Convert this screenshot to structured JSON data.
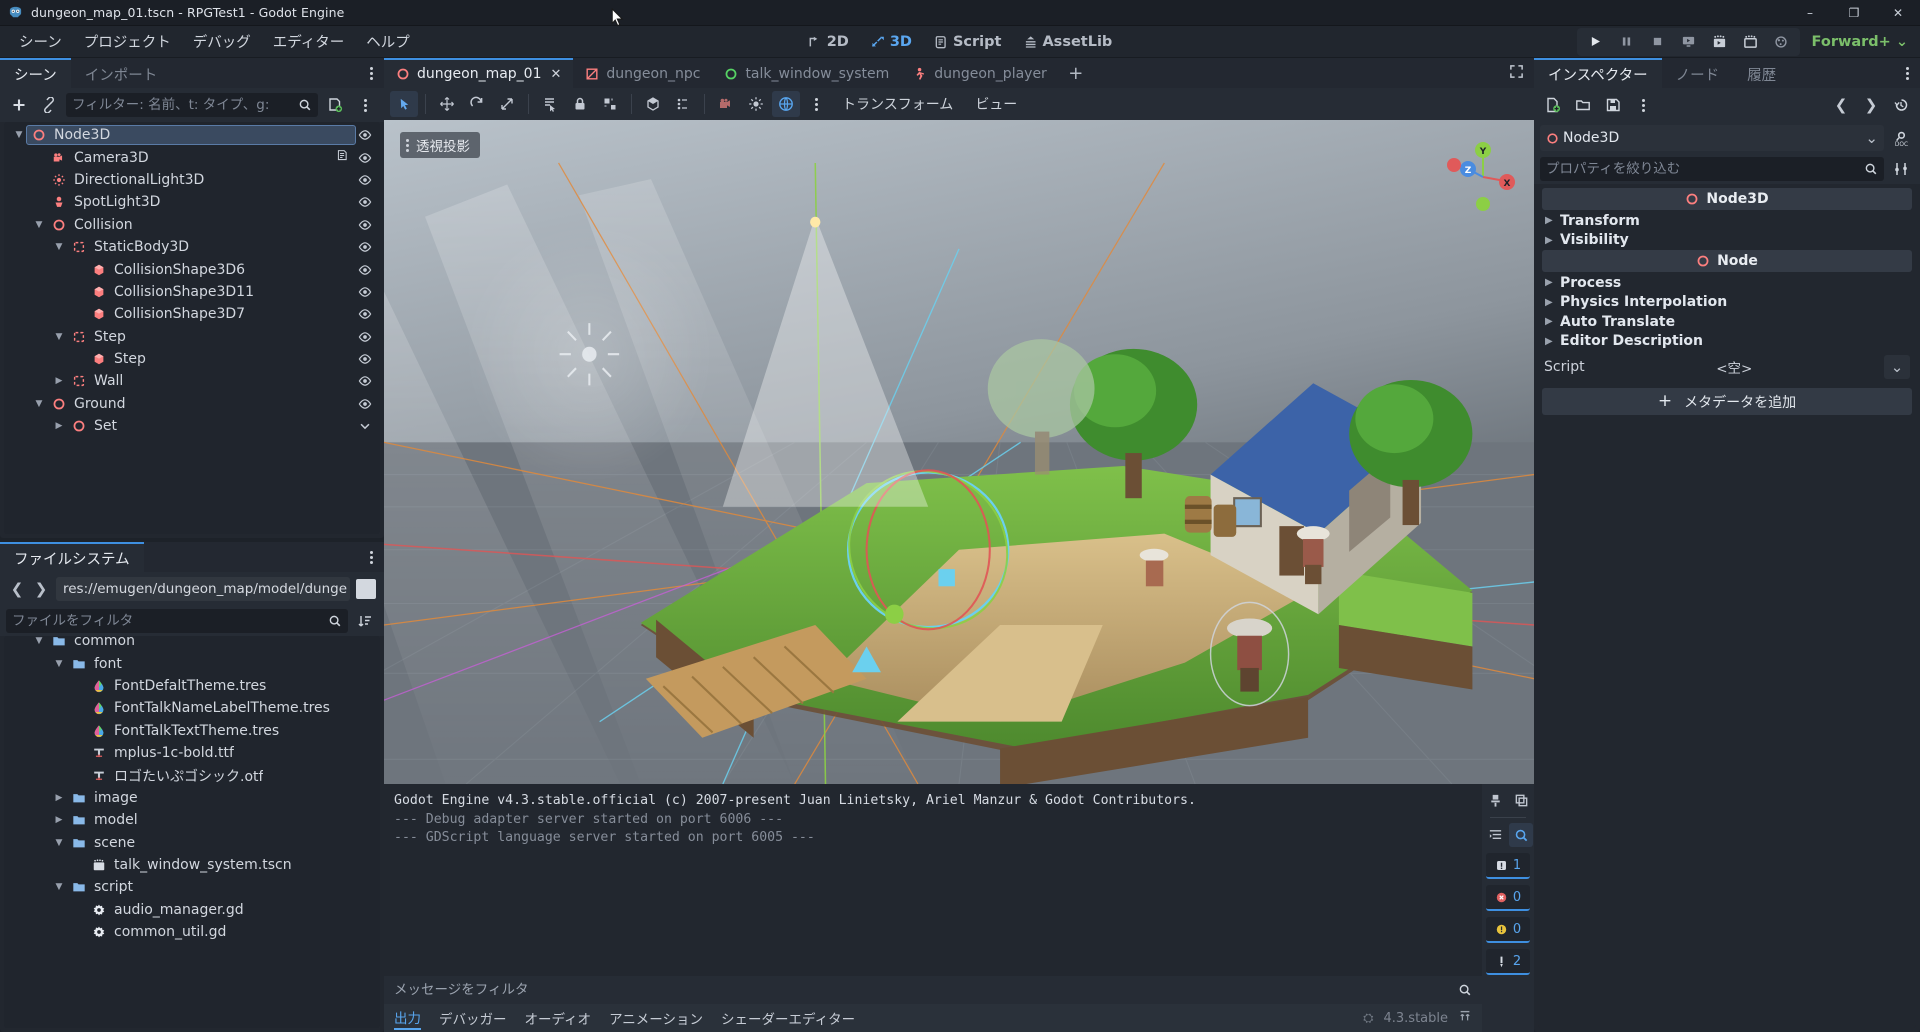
{
  "window": {
    "title": "dungeon_map_01.tscn - RPGTest1 - Godot Engine",
    "minimize": "–",
    "maximize": "❐",
    "close": "✕"
  },
  "menubar": {
    "items": [
      {
        "label": "シーン"
      },
      {
        "label": "プロジェクト"
      },
      {
        "label": "デバッグ"
      },
      {
        "label": "エディター"
      },
      {
        "label": "ヘルプ"
      }
    ],
    "main_tabs": [
      {
        "label": "2D",
        "active": false
      },
      {
        "label": "3D",
        "active": true
      },
      {
        "label": "Script",
        "active": false
      },
      {
        "label": "AssetLib",
        "active": false
      }
    ],
    "run_buttons": [
      {
        "name": "play-button"
      },
      {
        "name": "pause-button"
      },
      {
        "name": "stop-button"
      },
      {
        "name": "run-specific-scene-button"
      },
      {
        "name": "movie-maker-button"
      },
      {
        "name": "remote-debug-button"
      },
      {
        "name": "render-settings-button"
      }
    ],
    "renderer": "Forward+"
  },
  "scene_dock": {
    "tabs": [
      {
        "label": "シーン",
        "active": true
      },
      {
        "label": "インポート",
        "active": false
      }
    ],
    "filter_placeholder": "フィルター: 名前、t: タイプ、g:",
    "tree": [
      {
        "label": "Node3D",
        "depth": 0,
        "icon": "node3d",
        "arrow": "down",
        "selected": true,
        "eye": "visible"
      },
      {
        "label": "Camera3D",
        "depth": 1,
        "icon": "camera",
        "arrow": "none",
        "selected": false,
        "eye": "visible",
        "extra": "script-icon"
      },
      {
        "label": "DirectionalLight3D",
        "depth": 1,
        "icon": "sunlight",
        "arrow": "none",
        "selected": false,
        "eye": "visible"
      },
      {
        "label": "SpotLight3D",
        "depth": 1,
        "icon": "spotlight",
        "arrow": "none",
        "selected": false,
        "eye": "visible"
      },
      {
        "label": "Collision",
        "depth": 1,
        "icon": "node3d",
        "arrow": "down",
        "selected": false,
        "eye": "visible"
      },
      {
        "label": "StaticBody3D",
        "depth": 2,
        "icon": "body",
        "arrow": "down",
        "selected": false,
        "eye": "visible"
      },
      {
        "label": "CollisionShape3D6",
        "depth": 3,
        "icon": "shape",
        "arrow": "none",
        "selected": false,
        "eye": "visible"
      },
      {
        "label": "CollisionShape3D11",
        "depth": 3,
        "icon": "shape",
        "arrow": "none",
        "selected": false,
        "eye": "visible"
      },
      {
        "label": "CollisionShape3D7",
        "depth": 3,
        "icon": "shape",
        "arrow": "none",
        "selected": false,
        "eye": "visible"
      },
      {
        "label": "Step",
        "depth": 2,
        "icon": "body",
        "arrow": "down",
        "selected": false,
        "eye": "visible"
      },
      {
        "label": "Step",
        "depth": 3,
        "icon": "shape",
        "arrow": "none",
        "selected": false,
        "eye": "visible"
      },
      {
        "label": "Wall",
        "depth": 2,
        "icon": "body",
        "arrow": "right",
        "selected": false,
        "eye": "visible"
      },
      {
        "label": "Ground",
        "depth": 1,
        "icon": "node3d",
        "arrow": "down",
        "selected": false,
        "eye": "visible"
      },
      {
        "label": "Set",
        "depth": 2,
        "icon": "node3d",
        "arrow": "right",
        "selected": false,
        "eye": "chevron"
      }
    ]
  },
  "filesystem_dock": {
    "tabs": [
      {
        "label": "ファイルシステム",
        "active": true
      }
    ],
    "path": "res://emugen/dungeon_map/model/dunge",
    "filter_placeholder": "ファイルをフィルタ",
    "tree": [
      {
        "label": "common",
        "depth": 1,
        "icon": "folder",
        "arrow": "down",
        "partial": true
      },
      {
        "label": "font",
        "depth": 2,
        "icon": "folder",
        "arrow": "down"
      },
      {
        "label": "FontDefaltTheme.tres",
        "depth": 3,
        "icon": "theme",
        "arrow": "none"
      },
      {
        "label": "FontTalkNameLabelTheme.tres",
        "depth": 3,
        "icon": "theme",
        "arrow": "none"
      },
      {
        "label": "FontTalkTextTheme.tres",
        "depth": 3,
        "icon": "theme",
        "arrow": "none"
      },
      {
        "label": "mplus-1c-bold.ttf",
        "depth": 3,
        "icon": "font",
        "arrow": "none"
      },
      {
        "label": "ロゴたいぷゴシック.otf",
        "depth": 3,
        "icon": "font",
        "arrow": "none"
      },
      {
        "label": "image",
        "depth": 2,
        "icon": "folder",
        "arrow": "right"
      },
      {
        "label": "model",
        "depth": 2,
        "icon": "folder",
        "arrow": "right"
      },
      {
        "label": "scene",
        "depth": 2,
        "icon": "folder",
        "arrow": "down"
      },
      {
        "label": "talk_window_system.tscn",
        "depth": 3,
        "icon": "scene",
        "arrow": "none"
      },
      {
        "label": "script",
        "depth": 2,
        "icon": "folder",
        "arrow": "down"
      },
      {
        "label": "audio_manager.gd",
        "depth": 3,
        "icon": "gd",
        "arrow": "none"
      },
      {
        "label": "common_util.gd",
        "depth": 3,
        "icon": "gd",
        "arrow": "none"
      }
    ]
  },
  "scene_tabs": [
    {
      "label": "dungeon_map_01",
      "icon": "node3d",
      "active": true,
      "closable": true
    },
    {
      "label": "dungeon_npc",
      "icon": "sprite",
      "active": false,
      "closable": false
    },
    {
      "label": "talk_window_system",
      "icon": "control",
      "active": false,
      "closable": false
    },
    {
      "label": "dungeon_player",
      "icon": "player",
      "active": false,
      "closable": false
    }
  ],
  "viewport_toolbar": {
    "buttons": [
      {
        "name": "select-mode-button",
        "on": true
      },
      {
        "name": "move-mode-button",
        "on": false
      },
      {
        "name": "rotate-mode-button",
        "on": false
      },
      {
        "name": "scale-mode-button",
        "on": false
      },
      {
        "name": "list-select-button",
        "on": false
      },
      {
        "name": "lock-button",
        "on": false
      },
      {
        "name": "group-button",
        "on": false
      },
      {
        "name": "local-space-button",
        "on": false
      },
      {
        "name": "snap-button",
        "on": false
      },
      {
        "name": "camera-preview-button",
        "on": false
      },
      {
        "name": "preview-sun-button",
        "on": false
      },
      {
        "name": "preview-env-button",
        "on": true
      },
      {
        "name": "viewport-options-button",
        "on": false
      }
    ],
    "transform_menu": "トランスフォーム",
    "view_menu": "ビュー",
    "projection_label": "透視投影",
    "gizmo_axes": [
      {
        "label": "Y",
        "color": "#8ccf45"
      },
      {
        "label": "X",
        "color": "#e05a5a"
      },
      {
        "label": "Z",
        "color": "#4a8ce0"
      }
    ]
  },
  "output": {
    "lines": [
      {
        "text": "Godot Engine v4.3.stable.official (c) 2007-present Juan Linietsky, Ariel Manzur & Godot Contributors.",
        "dim": false
      },
      {
        "text": "--- Debug adapter server started on port 6006 ---",
        "dim": true
      },
      {
        "text": "--- GDScript language server started on port 6005 ---",
        "dim": true
      }
    ],
    "filter_placeholder": "メッセージをフィルタ",
    "bottom_tabs": [
      {
        "label": "出力",
        "active": true
      },
      {
        "label": "デバッガー",
        "active": false
      },
      {
        "label": "オーディオ",
        "active": false
      },
      {
        "label": "アニメーション",
        "active": false
      },
      {
        "label": "シェーダーエディター",
        "active": false
      }
    ],
    "version": "4.3.stable",
    "counters": [
      {
        "name": "message-count",
        "value": "1",
        "icon": "info-square"
      },
      {
        "name": "error-count",
        "value": "0",
        "icon": "error-circle"
      },
      {
        "name": "warning-count",
        "value": "0",
        "icon": "warning-circle"
      },
      {
        "name": "editor-count",
        "value": "2",
        "icon": "pin"
      }
    ]
  },
  "inspector": {
    "tabs": [
      {
        "label": "インスペクター",
        "active": true
      },
      {
        "label": "ノード",
        "active": false
      },
      {
        "label": "履歴",
        "active": false
      }
    ],
    "object": "Node3D",
    "filter_placeholder": "プロパティを絞り込む",
    "sections": [
      {
        "kind": "header",
        "label": "Node3D"
      },
      {
        "kind": "prop",
        "label": "Transform"
      },
      {
        "kind": "prop",
        "label": "Visibility"
      },
      {
        "kind": "header",
        "label": "Node"
      },
      {
        "kind": "prop",
        "label": "Process"
      },
      {
        "kind": "prop",
        "label": "Physics Interpolation"
      },
      {
        "kind": "prop",
        "label": "Auto Translate"
      },
      {
        "kind": "prop",
        "label": "Editor Description"
      }
    ],
    "script_label": "Script",
    "script_value": "<空>",
    "add_metadata": "メタデータを追加"
  },
  "colors": {
    "accent": "#3e8fe0",
    "node3d_red": "#fc7f7f",
    "green": "#7bbf6a",
    "bg_dark": "#1d2229",
    "panel": "#262c35"
  }
}
